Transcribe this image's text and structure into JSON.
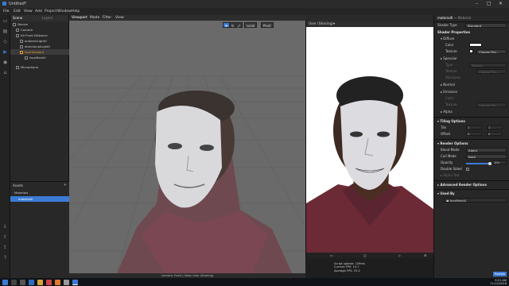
{
  "window": {
    "title": "Untitled*",
    "min": "–",
    "max": "□",
    "close": "✕"
  },
  "menu": [
    "File",
    "Edit",
    "View",
    "Add",
    "Project",
    "Window",
    "Help"
  ],
  "scene_panel": {
    "tabs": [
      "Scene",
      "Layers"
    ],
    "items": [
      {
        "label": "Device",
        "depth": 0,
        "selected": false
      },
      {
        "label": "Camera",
        "depth": 1,
        "selected": false
      },
      {
        "label": "Kit Front Distance",
        "depth": 1,
        "selected": false
      },
      {
        "label": "ambientLight0",
        "depth": 2,
        "selected": false
      },
      {
        "label": "directionalLight0",
        "depth": 2,
        "selected": false
      },
      {
        "label": "faceTracker0",
        "depth": 2,
        "selected": true
      },
      {
        "label": "faceMesh0",
        "depth": 3,
        "selected": false
      },
      {
        "label": "Microphone",
        "depth": 1,
        "selected": false
      }
    ]
  },
  "assets_panel": {
    "title": "Assets",
    "add": "+",
    "items": [
      {
        "label": "Materials",
        "selected": false
      },
      {
        "label": "material0",
        "selected": true
      }
    ]
  },
  "viewport": {
    "tabs": [
      "Viewport",
      "Mode",
      "Filter",
      "View"
    ],
    "buttons": [
      "Local",
      "Pivot"
    ],
    "footer": "Camera: Front | View: User (Sharing)",
    "stats": [
      "Script uptime: 109ms",
      "Current FPS: 14.7",
      "Average FPS: 15.2"
    ]
  },
  "preview": {
    "title": "User (Sharing)",
    "menu": "▾"
  },
  "inspector": {
    "title": "material0",
    "type_label": "Material",
    "shader_type_label": "Shader Type",
    "shader_type_value": "Standard",
    "shader_properties": "Shader Properties",
    "diffuse": "Diffuse",
    "color": "Color",
    "texture": "Texture",
    "choose_file": "Choose File...",
    "specular": "Specular",
    "type": "Type",
    "type_value": "Texture",
    "shininess": "Shininess",
    "normal": "Normal",
    "emissive": "Emissive",
    "alpha": "Alpha",
    "tiling_options": "Tiling Options",
    "tile": "Tile",
    "offset": "Offset",
    "tile_x": "1",
    "tile_y": "1",
    "offset_x": "0",
    "offset_y": "0",
    "render_options": "Render Options",
    "blend_mode": "Blend Mode",
    "blend_mode_value": "Alpha",
    "cull_mode": "Cull Mode",
    "cull_mode_value": "Back",
    "opacity": "Opacity",
    "opacity_value": "100",
    "opacity_fraction": 1.0,
    "double_sided": "Double Sided",
    "alpha_test": "Alpha Test",
    "advanced_render": "Advanced Render Options",
    "used_by": "Used By",
    "used_item": "faceMesh0",
    "publish": "Publish"
  },
  "taskbar": {
    "time": "9:21 AM",
    "date": "11/12/2018"
  }
}
